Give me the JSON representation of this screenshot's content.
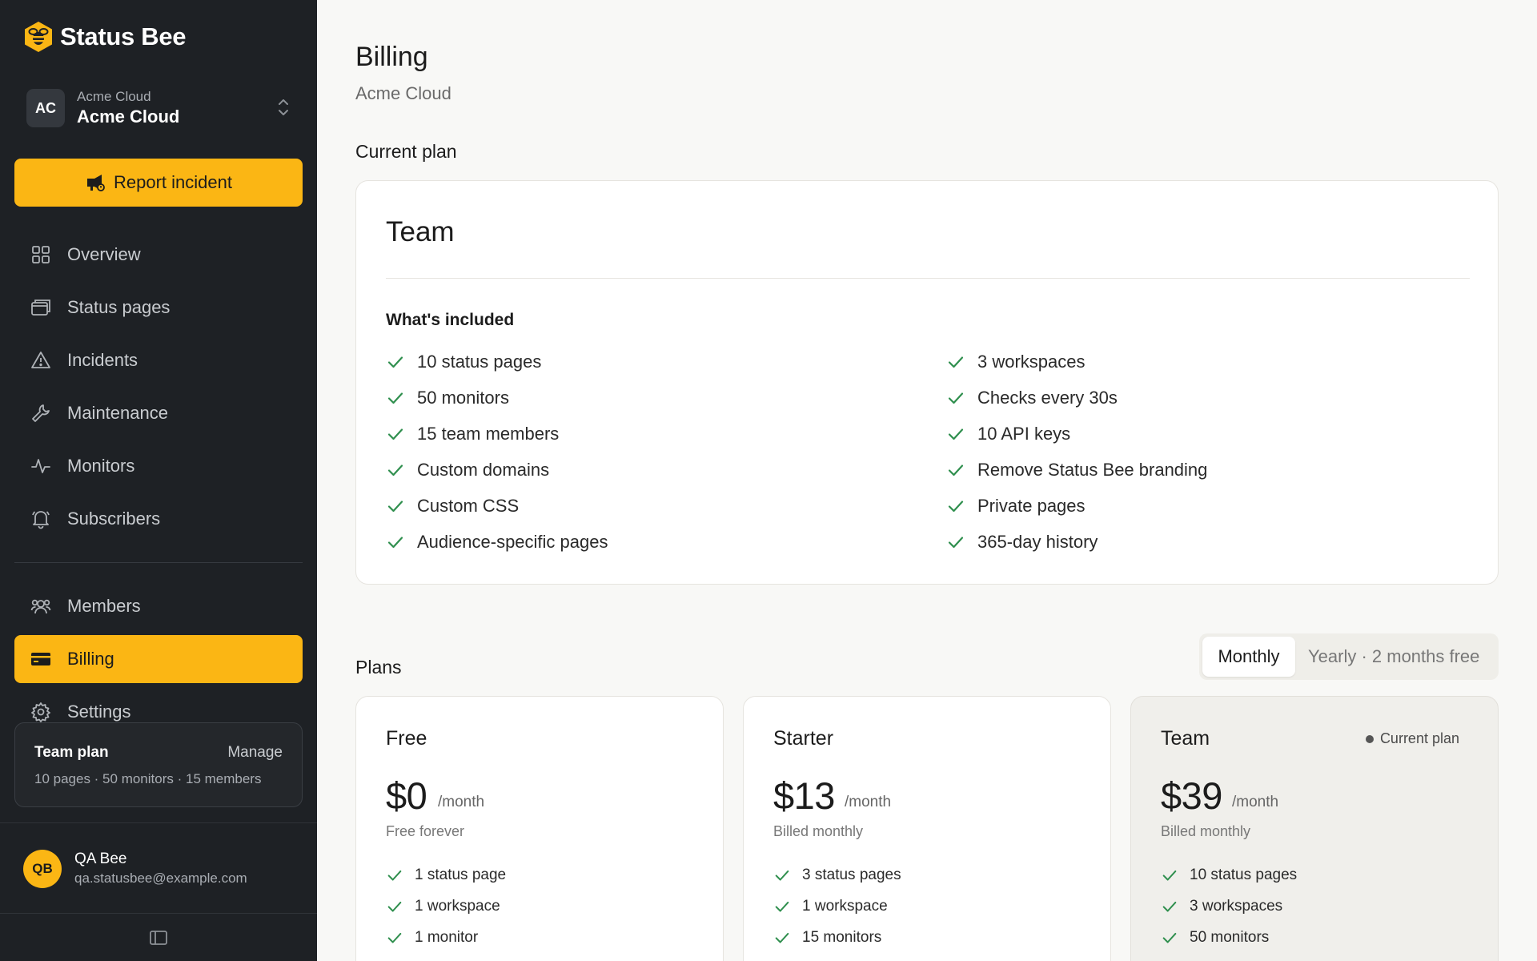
{
  "brand": {
    "name": "Status Bee"
  },
  "workspace": {
    "label": "Acme Cloud",
    "name": "Acme Cloud",
    "initials": "AC"
  },
  "report_button": {
    "label": "Report incident"
  },
  "nav": {
    "overview": "Overview",
    "status_pages": "Status pages",
    "incidents": "Incidents",
    "maintenance": "Maintenance",
    "monitors": "Monitors",
    "subscribers": "Subscribers",
    "members": "Members",
    "billing": "Billing",
    "settings": "Settings",
    "active": "billing"
  },
  "plan_summary": {
    "title": "Team plan",
    "manage": "Manage",
    "meta": "10 pages · 50 monitors · 15 members"
  },
  "user": {
    "initials": "QB",
    "name": "QA Bee",
    "email": "qa.statusbee@example.com"
  },
  "page": {
    "title": "Billing",
    "subtitle": "Acme Cloud"
  },
  "current_plan": {
    "section_title": "Current plan",
    "name": "Team",
    "included_title": "What's included",
    "features_left": [
      "10 status pages",
      "50 monitors",
      "15 team members",
      "Custom domains",
      "Custom CSS",
      "Audience-specific pages"
    ],
    "features_right": [
      "3 workspaces",
      "Checks every 30s",
      "10 API keys",
      "Remove Status Bee branding",
      "Private pages",
      "365-day history"
    ]
  },
  "plans": {
    "section_title": "Plans",
    "toggle": {
      "monthly": "Monthly",
      "yearly": "Yearly · 2 months free",
      "selected": "Monthly"
    },
    "cards": [
      {
        "name": "Free",
        "price": "$0",
        "per": "/month",
        "billed": "Free forever",
        "features": [
          "1 status page",
          "1 workspace",
          "1 monitor"
        ]
      },
      {
        "name": "Starter",
        "price": "$13",
        "per": "/month",
        "billed": "Billed monthly",
        "features": [
          "3 status pages",
          "1 workspace",
          "15 monitors"
        ]
      },
      {
        "name": "Team",
        "price": "$39",
        "per": "/month",
        "billed": "Billed monthly",
        "badge": "Current plan",
        "features": [
          "10 status pages",
          "3 workspaces",
          "50 monitors"
        ]
      }
    ]
  },
  "colors": {
    "accent": "#fbb614",
    "sidebar_bg": "#1e2125",
    "check": "#2f8f4e"
  }
}
